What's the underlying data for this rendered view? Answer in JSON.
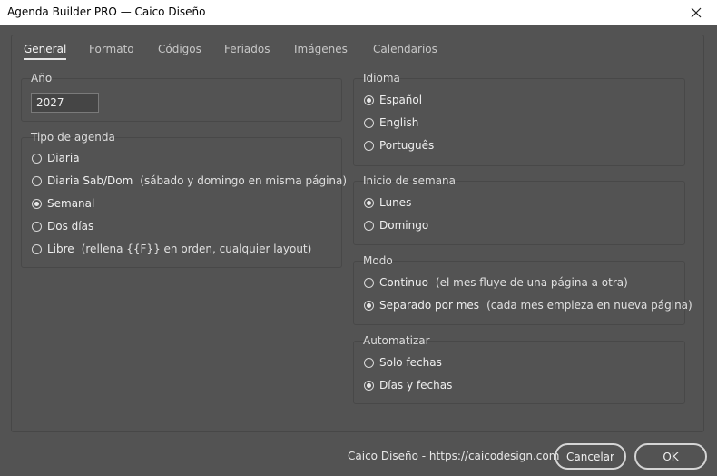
{
  "window": {
    "title": "Agenda Builder PRO — Caico Diseño",
    "close_icon": "close-icon"
  },
  "tabs": [
    {
      "label": "General",
      "active": true
    },
    {
      "label": "Formato"
    },
    {
      "label": "Códigos"
    },
    {
      "label": "Feriados"
    },
    {
      "label": "Imágenes"
    },
    {
      "label": "Calendarios"
    }
  ],
  "year": {
    "label": "Año",
    "value": "2027"
  },
  "agenda_type": {
    "label": "Tipo de agenda",
    "options": [
      {
        "label": "Diaria",
        "note": ""
      },
      {
        "label": "Diaria Sab/Dom",
        "note": "(sábado y domingo en misma página)"
      },
      {
        "label": "Semanal",
        "note": "",
        "selected": true
      },
      {
        "label": "Dos días",
        "note": ""
      },
      {
        "label": "Libre",
        "note": "(rellena {{F}} en orden, cualquier layout)"
      }
    ]
  },
  "language": {
    "label": "Idioma",
    "options": [
      {
        "label": "Español",
        "selected": true
      },
      {
        "label": "English"
      },
      {
        "label": "Português"
      }
    ]
  },
  "week_start": {
    "label": "Inicio de semana",
    "options": [
      {
        "label": "Lunes",
        "selected": true
      },
      {
        "label": "Domingo"
      }
    ]
  },
  "mode": {
    "label": "Modo",
    "options": [
      {
        "label": "Continuo",
        "note": "(el mes fluye de una página a otra)"
      },
      {
        "label": "Separado por mes",
        "note": "(cada mes empieza en nueva página)",
        "selected": true
      }
    ]
  },
  "automate": {
    "label": "Automatizar",
    "options": [
      {
        "label": "Solo fechas"
      },
      {
        "label": "Días y fechas",
        "selected": true
      }
    ]
  },
  "footer": {
    "credit": "Caico Diseño - https://caicodesign.com",
    "cancel_label": "Cancelar",
    "ok_label": "OK"
  }
}
